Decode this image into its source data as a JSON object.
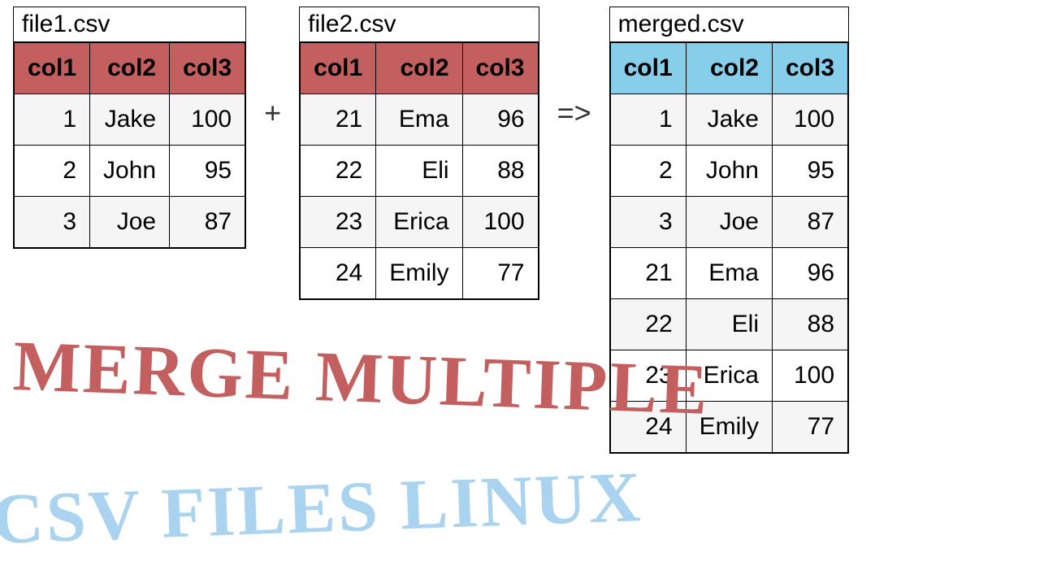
{
  "tables": [
    {
      "title": "file1.csv",
      "headerClass": "header-red",
      "columns": [
        "col1",
        "col2",
        "col3"
      ],
      "rows": [
        [
          "1",
          "Jake",
          "100"
        ],
        [
          "2",
          "John",
          "95"
        ],
        [
          "3",
          "Joe",
          "87"
        ]
      ]
    },
    {
      "title": "file2.csv",
      "headerClass": "header-red",
      "columns": [
        "col1",
        "col2",
        "col3"
      ],
      "rows": [
        [
          "21",
          "Ema",
          "96"
        ],
        [
          "22",
          "Eli",
          "88"
        ],
        [
          "23",
          "Erica",
          "100"
        ],
        [
          "24",
          "Emily",
          "77"
        ]
      ]
    },
    {
      "title": "merged.csv",
      "headerClass": "header-blue",
      "columns": [
        "col1",
        "col2",
        "col3"
      ],
      "rows": [
        [
          "1",
          "Jake",
          "100"
        ],
        [
          "2",
          "John",
          "95"
        ],
        [
          "3",
          "Joe",
          "87"
        ],
        [
          "21",
          "Ema",
          "96"
        ],
        [
          "22",
          "Eli",
          "88"
        ],
        [
          "23",
          "Erica",
          "100"
        ],
        [
          "24",
          "Emily",
          "77"
        ]
      ]
    }
  ],
  "operators": {
    "plus": "+",
    "arrow": "=>"
  },
  "handwriting": {
    "line1": "MERGE MULTIPLE",
    "line2": "CSV FILES LINUX"
  }
}
